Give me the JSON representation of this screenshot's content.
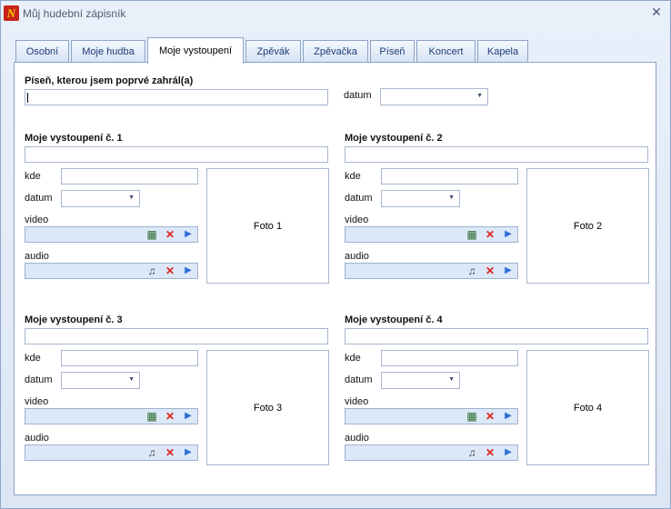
{
  "window": {
    "title": "Můj hudební zápisník"
  },
  "tabs": [
    {
      "label": "Osobní"
    },
    {
      "label": "Moje hudba"
    },
    {
      "label": "Moje vystoupení"
    },
    {
      "label": "Zpěvák"
    },
    {
      "label": "Zpěvačka"
    },
    {
      "label": "Píseň"
    },
    {
      "label": "Koncert"
    },
    {
      "label": "Kapela"
    }
  ],
  "first_song": {
    "label": "Píseň, kterou jsem poprvé zahrál(a)",
    "value": "",
    "date_label": "datum",
    "date_value": ""
  },
  "performances": [
    {
      "title": "Moje vystoupení č. 1",
      "kde": "kde",
      "datum": "datum",
      "video": "video",
      "audio": "audio",
      "photo": "Foto 1"
    },
    {
      "title": "Moje vystoupení č. 2",
      "kde": "kde",
      "datum": "datum",
      "video": "video",
      "audio": "audio",
      "photo": "Foto 2"
    },
    {
      "title": "Moje vystoupení č. 3",
      "kde": "kde",
      "datum": "datum",
      "video": "video",
      "audio": "audio",
      "photo": "Foto 3"
    },
    {
      "title": "Moje vystoupení č. 4",
      "kde": "kde",
      "datum": "datum",
      "video": "video",
      "audio": "audio",
      "photo": "Foto 4"
    }
  ],
  "icons": {
    "film": "film-icon",
    "music": "music-note-icon",
    "delete": "delete-x-icon",
    "play": "play-icon",
    "close": "close-icon"
  }
}
